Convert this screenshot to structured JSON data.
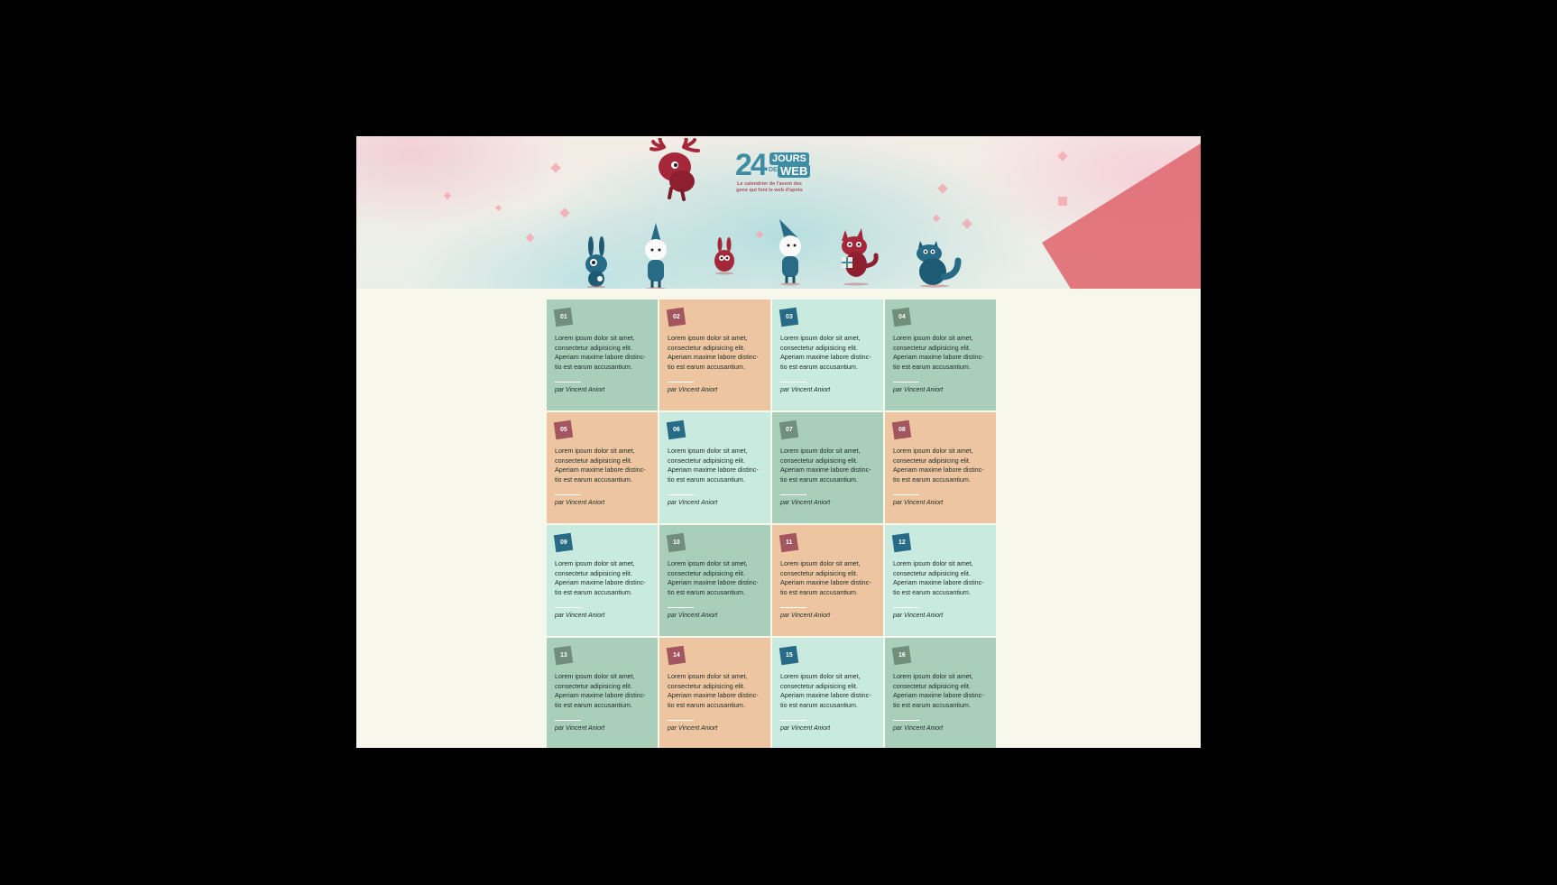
{
  "site": {
    "logo_number": "24",
    "logo_jours": "JOURS",
    "logo_de": "DE",
    "logo_web": "WEB",
    "tagline": "Le calendrier de l'avent des gens qui font le web d'après"
  },
  "colors": {
    "page_bg": "#f8f7eb",
    "card_green": "#a9cfba",
    "card_orange": "#edc6a1",
    "card_mint": "#c9eadf",
    "badge_gray": "#718e7a",
    "badge_red": "#a35660",
    "badge_blue": "#286b86",
    "brand_blue": "#3e8da3",
    "brand_red": "#a5273a"
  },
  "characters": [
    "moose-icon",
    "bunny-icon",
    "gnome-icon",
    "rabbit-icon",
    "gnome-icon",
    "wolf-icon",
    "blue-creature-icon"
  ],
  "cards": [
    {
      "day": "01",
      "color": "green",
      "badge": "gray",
      "text": "Lorem ipsum dolor sit amet, consectetur adipisicing elit. Aperiam maxime labore distinc-tio est earum accusantium.",
      "author": "par Vincent Aniort"
    },
    {
      "day": "02",
      "color": "orange",
      "badge": "red",
      "text": "Lorem ipsum dolor sit amet, consectetur adipisicing elit. Aperiam maxime labore distinc-tio est earum accusantium.",
      "author": "par Vincent Aniort"
    },
    {
      "day": "03",
      "color": "mint",
      "badge": "blue",
      "text": "Lorem ipsum dolor sit amet, consectetur adipisicing elit. Aperiam maxime labore distinc-tio est earum accusantium.",
      "author": "par Vincent Aniort"
    },
    {
      "day": "04",
      "color": "green",
      "badge": "gray",
      "text": "Lorem ipsum dolor sit amet, consectetur adipisicing elit. Aperiam maxime labore distinc-tio est earum accusantium.",
      "author": "par Vincent Aniort"
    },
    {
      "day": "05",
      "color": "orange",
      "badge": "red",
      "text": "Lorem ipsum dolor sit amet, consectetur adipisicing elit. Aperiam maxime labore distinc-tio est earum accusantium.",
      "author": "par Vincent Aniort"
    },
    {
      "day": "06",
      "color": "mint",
      "badge": "blue",
      "text": "Lorem ipsum dolor sit amet, consectetur adipisicing elit. Aperiam maxime labore distinc-tio est earum accusantium.",
      "author": "par Vincent Aniort"
    },
    {
      "day": "07",
      "color": "green",
      "badge": "gray",
      "text": "Lorem ipsum dolor sit amet, consectetur adipisicing elit. Aperiam maxime labore distinc-tio est earum accusantium.",
      "author": "par Vincent Aniort"
    },
    {
      "day": "08",
      "color": "orange",
      "badge": "red",
      "text": "Lorem ipsum dolor sit amet, consectetur adipisicing elit. Aperiam maxime labore distinc-tio est earum accusantium.",
      "author": "par Vincent Aniort"
    },
    {
      "day": "09",
      "color": "mint",
      "badge": "blue",
      "text": "Lorem ipsum dolor sit amet, consectetur adipisicing elit. Aperiam maxime labore distinc-tio est earum accusantium.",
      "author": "par Vincent Aniort"
    },
    {
      "day": "10",
      "color": "green",
      "badge": "gray",
      "text": "Lorem ipsum dolor sit amet, consectetur adipisicing elit. Aperiam maxime labore distinc-tio est earum accusantium.",
      "author": "par Vincent Aniort"
    },
    {
      "day": "11",
      "color": "orange",
      "badge": "red",
      "text": "Lorem ipsum dolor sit amet, consectetur adipisicing elit. Aperiam maxime labore distinc-tio est earum accusantium.",
      "author": "par Vincent Aniort"
    },
    {
      "day": "12",
      "color": "mint",
      "badge": "blue",
      "text": "Lorem ipsum dolor sit amet, consectetur adipisicing elit. Aperiam maxime labore distinc-tio est earum accusantium.",
      "author": "par Vincent Aniort"
    },
    {
      "day": "13",
      "color": "green",
      "badge": "gray",
      "text": "Lorem ipsum dolor sit amet, consectetur adipisicing elit. Aperiam maxime labore distinc-tio est earum accusantium.",
      "author": "par Vincent Aniort"
    },
    {
      "day": "14",
      "color": "orange",
      "badge": "red",
      "text": "Lorem ipsum dolor sit amet, consectetur adipisicing elit. Aperiam maxime labore distinc-tio est earum accusantium.",
      "author": "par Vincent Aniort"
    },
    {
      "day": "15",
      "color": "mint",
      "badge": "blue",
      "text": "Lorem ipsum dolor sit amet, consectetur adipisicing elit. Aperiam maxime labore distinc-tio est earum accusantium.",
      "author": "par Vincent Aniort"
    },
    {
      "day": "16",
      "color": "green",
      "badge": "gray",
      "text": "Lorem ipsum dolor sit amet, consectetur adipisicing elit. Aperiam maxime labore distinc-tio est earum accusantium.",
      "author": "par Vincent Aniort"
    }
  ]
}
